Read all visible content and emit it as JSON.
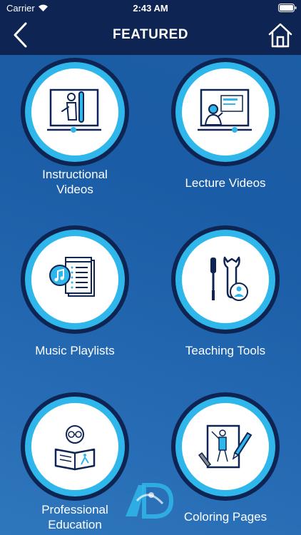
{
  "status": {
    "carrier": "Carrier",
    "time": "2:43 AM"
  },
  "header": {
    "title": "FEATURED"
  },
  "tiles": [
    {
      "label": "Instructional Videos",
      "line1": "Instructional",
      "line2": "Videos",
      "icon": "instructor-video-icon"
    },
    {
      "label": "Lecture Videos",
      "icon": "lecture-video-icon"
    },
    {
      "label": "Music Playlists",
      "icon": "music-playlist-icon"
    },
    {
      "label": "Teaching Tools",
      "icon": "teaching-tools-icon"
    },
    {
      "label": "Professional Education",
      "line1": "Professional",
      "line2": "Education",
      "icon": "reader-book-icon"
    },
    {
      "label": "Coloring Pages",
      "icon": "coloring-page-icon"
    }
  ],
  "colors": {
    "header": "#0e2452",
    "ring": "#2fb6ea",
    "background": "#1d5ea5"
  }
}
